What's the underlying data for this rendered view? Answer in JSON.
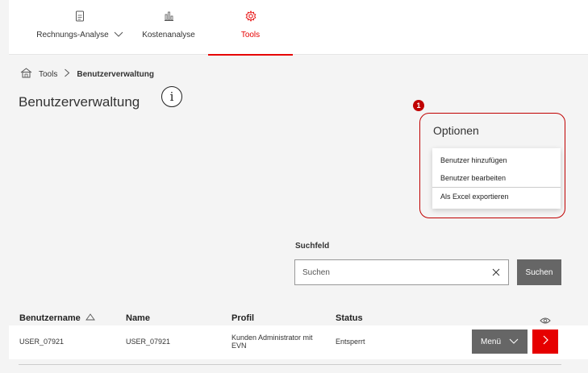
{
  "nav": {
    "tabs": [
      {
        "label": "Rechnungs-Analyse",
        "icon": "document-icon"
      },
      {
        "label": "Kostenanalyse",
        "icon": "bar-chart-icon"
      },
      {
        "label": "Tools",
        "icon": "gear-icon"
      }
    ],
    "active_tab": "Tools"
  },
  "breadcrumb": {
    "home_icon": "home-icon",
    "items": [
      "Tools",
      "Benutzerverwaltung"
    ]
  },
  "page": {
    "title": "Benutzerverwaltung",
    "info_glyph": "i",
    "marker": "1"
  },
  "options": {
    "title": "Optionen",
    "items": [
      "Benutzer hinzufügen",
      "Benutzer bearbeiten",
      "Als Excel exportieren"
    ]
  },
  "search": {
    "label": "Suchfeld",
    "placeholder": "Suchen",
    "value": "",
    "button": "Suchen"
  },
  "table": {
    "headers": [
      "Benutzername",
      "Name",
      "Profil",
      "Status"
    ],
    "rows": [
      {
        "username": "USER_07921",
        "name": "USER_07921",
        "profile": "Kunden Administrator mit EVN",
        "status": "Entsperrt",
        "menu_label": "Menü"
      }
    ]
  },
  "colors": {
    "accent": "#e60000",
    "highlight": "#c00000",
    "button_grey": "#666666"
  }
}
